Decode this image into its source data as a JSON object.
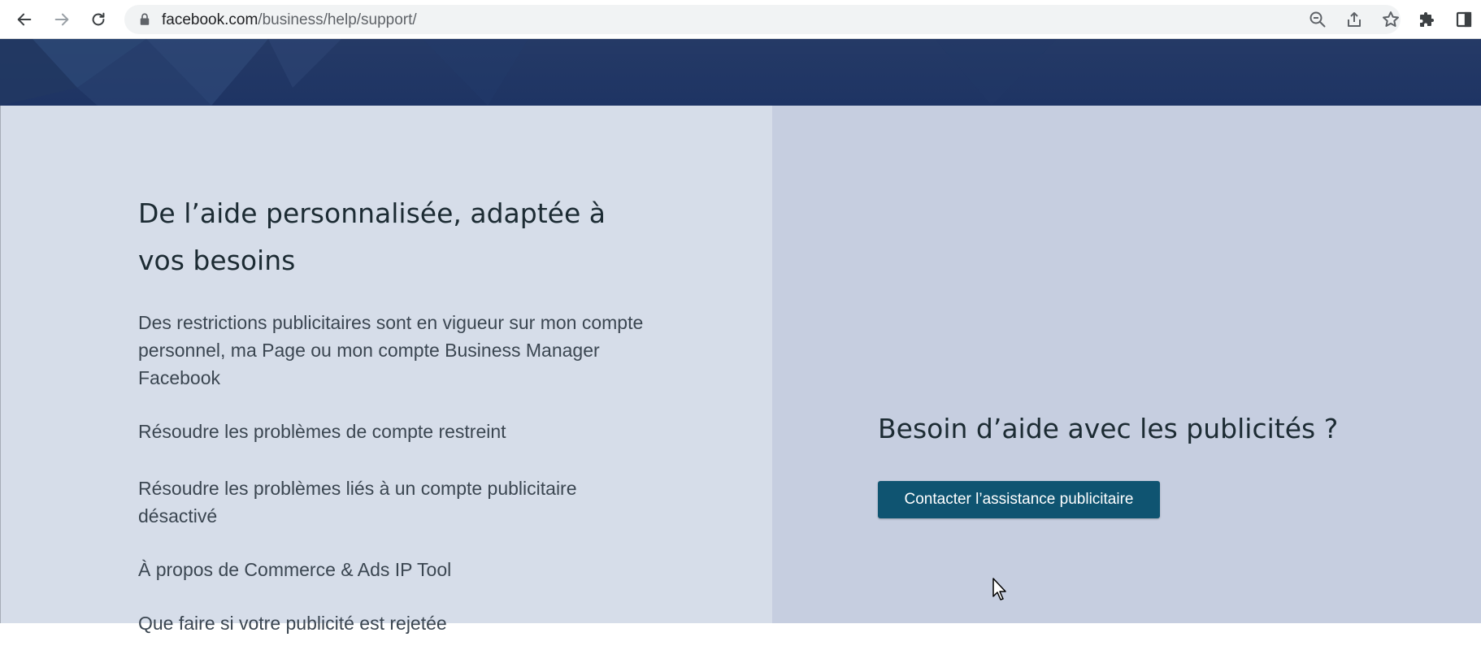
{
  "browser": {
    "url_host": "facebook.com",
    "url_path": "/business/help/support/",
    "icons": {
      "back": "arrow-left-icon",
      "forward": "arrow-right-icon",
      "reload": "reload-icon",
      "lock": "lock-icon",
      "zoom": "zoom-out-icon",
      "share": "share-icon",
      "bookmark": "star-icon",
      "extensions": "puzzle-icon",
      "side_panel": "side-panel-icon"
    }
  },
  "left": {
    "heading": "De l’aide personnalisée, adaptée à vos besoins",
    "links": [
      {
        "label": "Des restrictions publicitaires sont en vigueur sur mon compte personnel, ma Page ou mon compte Business Manager Facebook"
      },
      {
        "label": "Résoudre les problèmes de compte restreint"
      },
      {
        "label": "Résoudre les problèmes liés à un compte publicitaire désactivé"
      },
      {
        "label": "À propos de Commerce & Ads IP Tool"
      },
      {
        "label": "Que faire si votre publicité est rejetée"
      }
    ]
  },
  "right": {
    "heading": "Besoin d’aide avec les publicités ?",
    "button_label": "Contacter l’assistance publicitaire"
  },
  "colors": {
    "banner": "#253a66",
    "left_background": "#d6dde9",
    "right_background": "#c6cee0",
    "button": "#0f5471"
  }
}
